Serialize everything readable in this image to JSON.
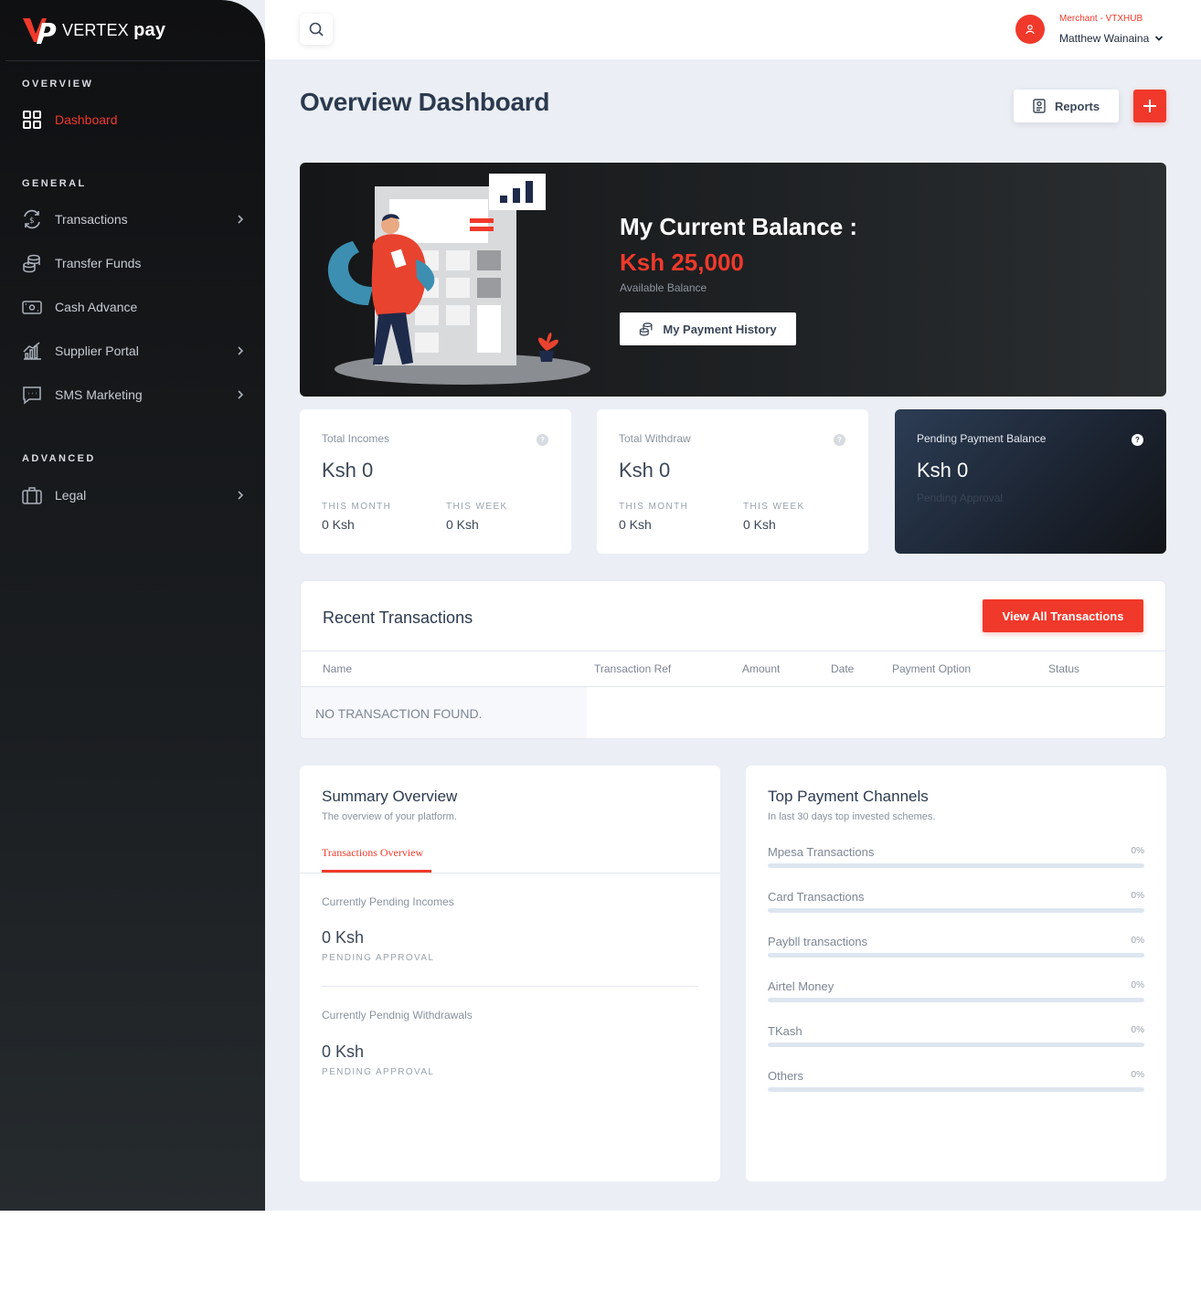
{
  "brand": {
    "name_light": "VERTEX",
    "name_bold": "pay"
  },
  "sidebar": {
    "sections": [
      {
        "label": "OVERVIEW"
      },
      {
        "label": "GENERAL"
      },
      {
        "label": "ADVANCED"
      }
    ],
    "items": [
      {
        "label": "Dashboard",
        "icon": "grid-icon",
        "active": true,
        "has_chevron": false
      },
      {
        "label": "Transactions",
        "icon": "exchange-dollar-icon",
        "has_chevron": true
      },
      {
        "label": "Transfer Funds",
        "icon": "coins-stack-icon",
        "has_chevron": false
      },
      {
        "label": "Cash Advance",
        "icon": "cash-icon",
        "has_chevron": false
      },
      {
        "label": "Supplier Portal",
        "icon": "bar-chart-icon",
        "has_chevron": true
      },
      {
        "label": "SMS Marketing",
        "icon": "chat-icon",
        "has_chevron": true
      },
      {
        "label": "Legal",
        "icon": "briefcase-icon",
        "has_chevron": true
      }
    ]
  },
  "topbar": {
    "merchant": "Merchant - VTXHUB",
    "user": "Matthew Wainaina"
  },
  "main": {
    "title": "Overview Dashboard",
    "reports_label": "Reports",
    "add_label": "+"
  },
  "balance": {
    "title": "My Current Balance :",
    "amount": "Ksh 25,000",
    "subtitle": "Available Balance",
    "history_label": "My Payment History"
  },
  "stats": [
    {
      "label": "Total Incomes",
      "value": "Ksh 0",
      "month_label": "THIS MONTH",
      "month_value": "0 Ksh",
      "week_label": "THIS WEEK",
      "week_value": "0 Ksh"
    },
    {
      "label": "Total Withdraw",
      "value": "Ksh 0",
      "month_label": "THIS MONTH",
      "month_value": "0 Ksh",
      "week_label": "THIS WEEK",
      "week_value": "0 Ksh"
    },
    {
      "label": "Pending Payment Balance",
      "value": "Ksh 0",
      "sub": "Pending Approval"
    }
  ],
  "transactions": {
    "title": "Recent Transactions",
    "view_all_label": "View All Transactions",
    "columns": [
      "Name",
      "Transaction Ref",
      "Amount",
      "Date",
      "Payment Option",
      "Status"
    ],
    "empty": "NO TRANSACTION FOUND."
  },
  "summary": {
    "title": "Summary Overview",
    "subtitle": "The overview of your platform.",
    "tab": "Transactions Overview",
    "items": [
      {
        "label": "Currently Pending Incomes",
        "value": "0 Ksh",
        "sub": "PENDING APPROVAL"
      },
      {
        "label": "Currently Pendnig Withdrawals",
        "value": "0 Ksh",
        "sub": "PENDING APPROVAL"
      }
    ]
  },
  "channels": {
    "title": "Top Payment Channels",
    "subtitle": "In last 30 days top invested schemes.",
    "items": [
      {
        "name": "Mpesa Transactions",
        "pct": "0%",
        "value": 0
      },
      {
        "name": "Card Transactions",
        "pct": "0%",
        "value": 0
      },
      {
        "name": "Paybll transactions",
        "pct": "0%",
        "value": 0
      },
      {
        "name": "Airtel Money",
        "pct": "0%",
        "value": 0
      },
      {
        "name": "TKash",
        "pct": "0%",
        "value": 0
      },
      {
        "name": "Others",
        "pct": "0%",
        "value": 0
      }
    ]
  },
  "colors": {
    "accent": "#f0392b",
    "sidebar": "#16181a",
    "background": "#ebeff5"
  }
}
